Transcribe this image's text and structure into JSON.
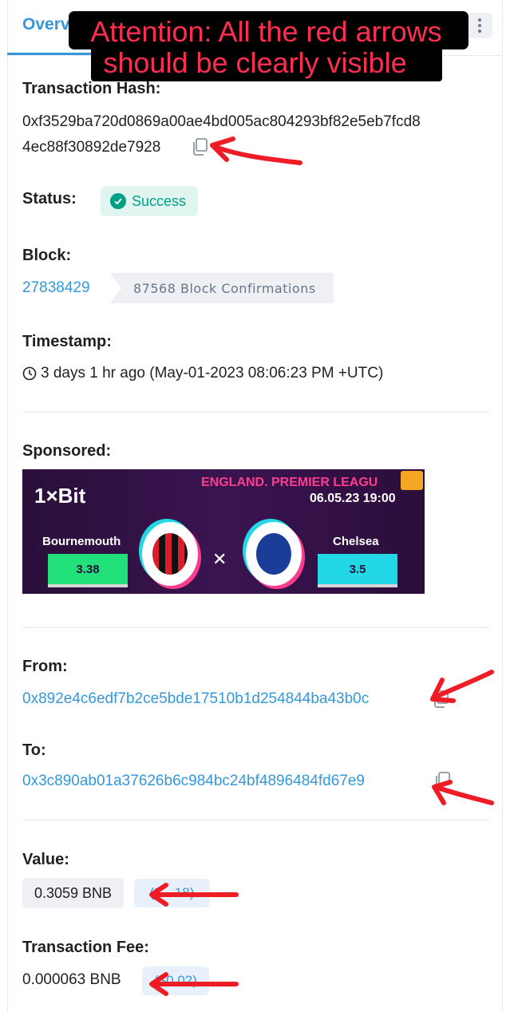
{
  "tabs": {
    "overview_label": "Overv"
  },
  "notice": {
    "line1": "Attention: All the red arrows",
    "line2": "should be clearly visible"
  },
  "transaction_hash": {
    "label": "Transaction Hash:",
    "line1": "0xf3529ba720d0869a00ae4bd005ac804293bf82e5eb7fcd8",
    "line2": "4ec88f30892de7928"
  },
  "status": {
    "label": "Status:",
    "value": "Success",
    "color": "#00a186"
  },
  "block": {
    "label": "Block:",
    "number": "27838429",
    "confirmations": "87568 Block Confirmations"
  },
  "timestamp": {
    "label": "Timestamp:",
    "value": "3 days 1 hr ago (May-01-2023 08:06:23 PM +UTC)"
  },
  "sponsored": {
    "label": "Sponsored:",
    "ad": {
      "brand": "1×Bit",
      "league": "ENGLAND. PREMIER LEAGU",
      "date": "06.05.23 19:00",
      "team_home": "Bournemouth",
      "team_away": "Chelsea",
      "odds_home": "3.38",
      "odds_away": "3.5"
    }
  },
  "from": {
    "label": "From:",
    "address": "0x892e4c6edf7b2ce5bde17510b1d254844ba43b0c"
  },
  "to": {
    "label": "To:",
    "address": "0x3c890ab01a37626b6c984bc24bf4896484fd67e9"
  },
  "value": {
    "label": "Value:",
    "amount": "0.3059 BNB",
    "usd": "($··.18)"
  },
  "fee": {
    "label": "Transaction Fee:",
    "amount": "0.000063 BNB",
    "usd": "($0.02)"
  },
  "colors": {
    "accent": "#3498db",
    "arrow": "#ee1c25",
    "text": "#1e2022"
  }
}
